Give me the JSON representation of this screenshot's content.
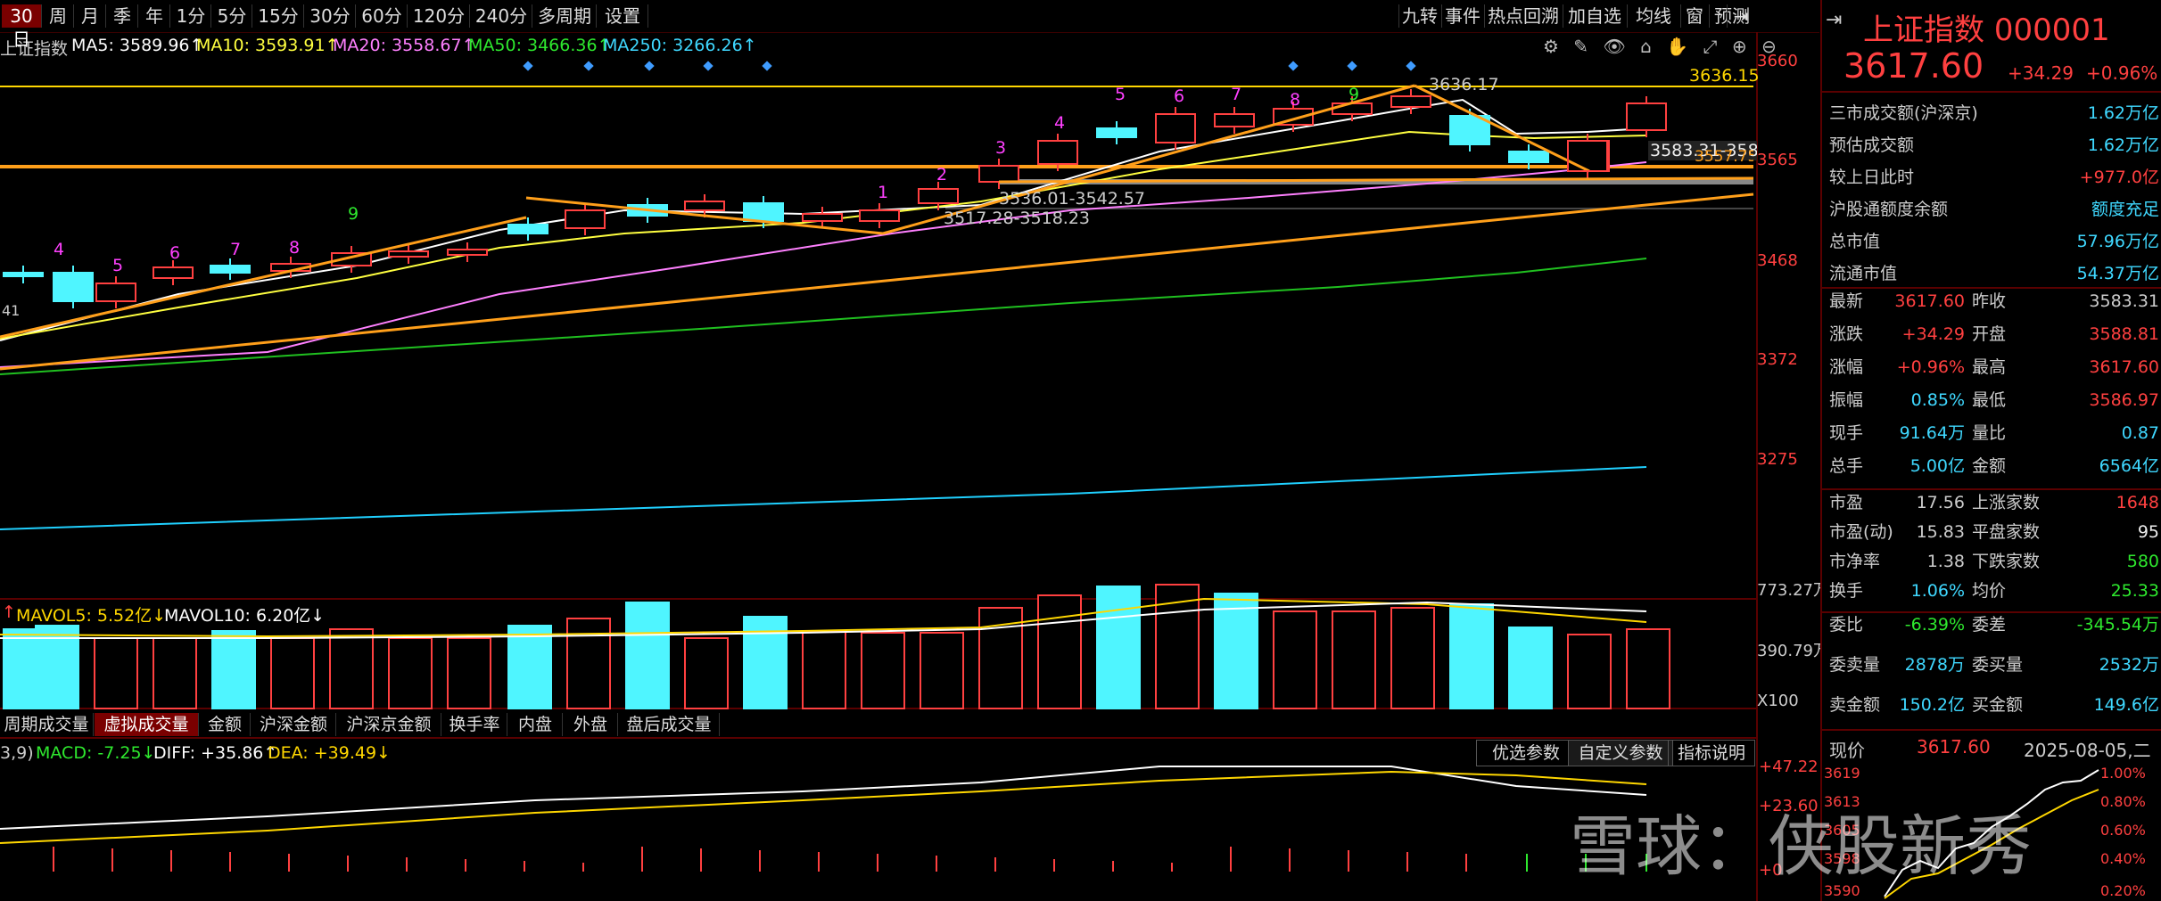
{
  "toolbar": {
    "periods": [
      "30日",
      "周",
      "月",
      "季",
      "年",
      "1分",
      "5分",
      "15分",
      "30分",
      "60分",
      "120分",
      "240分",
      "多周期",
      "设置"
    ],
    "right_tools": [
      "九转",
      "事件",
      "热点回溯",
      "加自选",
      "均线",
      "窗",
      "预测"
    ]
  },
  "ma_bar": {
    "name": "上证指数",
    "ma5": "MA5: 3589.96↑",
    "ma10": "MA10: 3593.91↑",
    "ma20": "MA20: 3558.67↑",
    "ma50": "MA50: 3466.36↑",
    "ma250": "MA250: 3266.26↑"
  },
  "price_axis": [
    "3660",
    "3565",
    "3468",
    "3372",
    "3275"
  ],
  "annotations": {
    "hline_label": "3636.15",
    "peak": "3636.17",
    "range1": "3536.01-3542.57",
    "range2": "3517.28-3518.23",
    "last_close": "3583.31-358",
    "support": "3557.75",
    "left_cut": "41"
  },
  "td_counts": [
    {
      "n": "4",
      "c": "#ff40ff"
    },
    {
      "n": "5",
      "c": "#ff40ff"
    },
    {
      "n": "6",
      "c": "#ff40ff"
    },
    {
      "n": "7",
      "c": "#ff40ff"
    },
    {
      "n": "8",
      "c": "#ff40ff"
    },
    {
      "n": "9",
      "c": "#2ee82e"
    },
    {
      "n": "1",
      "c": "#ff40ff"
    },
    {
      "n": "2",
      "c": "#ff40ff"
    },
    {
      "n": "3",
      "c": "#ff40ff"
    },
    {
      "n": "4",
      "c": "#ff40ff"
    },
    {
      "n": "5",
      "c": "#ff40ff"
    },
    {
      "n": "6",
      "c": "#ff40ff"
    },
    {
      "n": "7",
      "c": "#ff40ff"
    },
    {
      "n": "8",
      "c": "#ff40ff"
    },
    {
      "n": "9",
      "c": "#2ee82e"
    }
  ],
  "volume": {
    "mavol5": "MAVOL5: 5.52亿↓",
    "mavol10": "MAVOL10: 6.20亿↓",
    "axis_top": "773.27万",
    "axis_mid": "390.79万",
    "axis_unit": "X100"
  },
  "sub_tabs": [
    "周期成交量",
    "虚拟成交量",
    "金额",
    "沪深金额",
    "沪深京金额",
    "换手率",
    "内盘",
    "外盘",
    "盘后成交量"
  ],
  "macd": {
    "prefix": "3,9)",
    "macd": "MACD: -7.25↓",
    "diff": "DIFF: +35.86↑",
    "dea": "DEA: +39.49↓",
    "axis_top": "+47.22",
    "axis_mid": "+23.60",
    "axis_zero": "+0",
    "buttons": [
      "优选参数",
      "自定义参数",
      "指标说明"
    ]
  },
  "side": {
    "title": "上证指数",
    "code": "000001",
    "price": "3617.60",
    "change": "+34.29",
    "pct": "+0.96%",
    "info": [
      {
        "k": "三市成交额(沪深京)",
        "v": "1.62万亿",
        "c": "#3fd8ff"
      },
      {
        "k": "预估成交额",
        "v": "1.62万亿",
        "c": "#3fd8ff"
      },
      {
        "k": "较上日此时",
        "v": "+977.0亿",
        "c": "#ff4040"
      },
      {
        "k": "沪股通额度余额",
        "v": "额度充足",
        "c": "#3fd8ff"
      },
      {
        "k": "总市值",
        "v": "57.96万亿",
        "c": "#3fd8ff"
      },
      {
        "k": "流通市值",
        "v": "54.37万亿",
        "c": "#3fd8ff"
      }
    ],
    "quote": [
      {
        "k1": "最新",
        "v1": "3617.60",
        "c1": "#ff4040",
        "k2": "昨收",
        "v2": "3583.31",
        "c2": "#ccc"
      },
      {
        "k1": "涨跌",
        "v1": "+34.29",
        "c1": "#ff4040",
        "k2": "开盘",
        "v2": "3588.81",
        "c2": "#ff4040"
      },
      {
        "k1": "涨幅",
        "v1": "+0.96%",
        "c1": "#ff4040",
        "k2": "最高",
        "v2": "3617.60",
        "c2": "#ff4040"
      },
      {
        "k1": "振幅",
        "v1": "0.85%",
        "c1": "#3fd8ff",
        "k2": "最低",
        "v2": "3586.97",
        "c2": "#ff4040"
      },
      {
        "k1": "现手",
        "v1": "91.64万",
        "c1": "#3fd8ff",
        "k2": "量比",
        "v2": "0.87",
        "c2": "#3fd8ff"
      },
      {
        "k1": "总手",
        "v1": "5.00亿",
        "c1": "#3fd8ff",
        "k2": "金额",
        "v2": "6564亿",
        "c2": "#3fd8ff"
      }
    ],
    "market": [
      {
        "k1": "市盈",
        "v1": "17.56",
        "c1": "#ccc",
        "k2": "上涨家数",
        "v2": "1648",
        "c2": "#ff4040"
      },
      {
        "k1": "市盈(动)",
        "v1": "15.83",
        "c1": "#ccc",
        "k2": "平盘家数",
        "v2": "95",
        "c2": "#eee"
      },
      {
        "k1": "市净率",
        "v1": "1.38",
        "c1": "#ccc",
        "k2": "下跌家数",
        "v2": "580",
        "c2": "#2ee82e"
      },
      {
        "k1": "换手",
        "v1": "1.06%",
        "c1": "#3fd8ff",
        "k2": "均价",
        "v2": "25.33",
        "c2": "#2ee82e"
      }
    ],
    "orders": [
      {
        "k1": "委比",
        "v1": "-6.39%",
        "c1": "#2ee82e",
        "k2": "委差",
        "v2": "-345.54万",
        "c2": "#2ee82e"
      },
      {
        "k1": "委卖量",
        "v1": "2878万",
        "c1": "#3fd8ff",
        "k2": "委买量",
        "v2": "2532万",
        "c2": "#3fd8ff"
      },
      {
        "k1": "卖金额",
        "v1": "150.2亿",
        "c1": "#3fd8ff",
        "k2": "买金额",
        "v2": "149.6亿",
        "c2": "#3fd8ff"
      }
    ],
    "mini": {
      "label": "现价",
      "price": "3617.60",
      "date": "2025-08-05,二",
      "left_axis": [
        "3619",
        "3613",
        "3605",
        "3598",
        "3590"
      ],
      "right_axis": [
        "1.00%",
        "0.80%",
        "0.60%",
        "0.40%",
        "0.20%"
      ]
    }
  },
  "watermark": "雪球：侠股新秀",
  "colors": {
    "up": "#ff4040",
    "down": "#4ff5ff",
    "ma5": "#ffffff",
    "ma10": "#ffff40",
    "ma20": "#ff80ff",
    "ma50": "#20c020",
    "ma250": "#20d0ff",
    "trend": "#ff9f1a"
  }
}
